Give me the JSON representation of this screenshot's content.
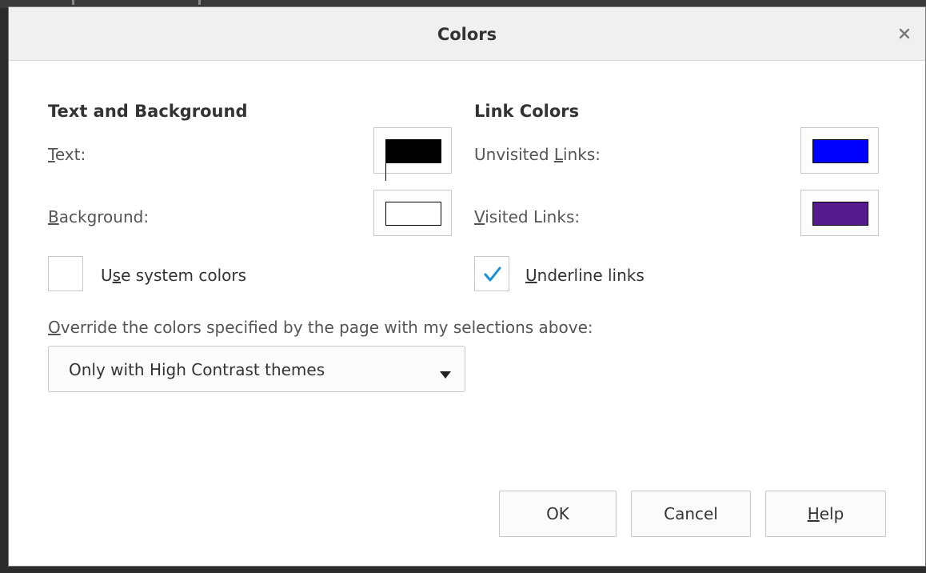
{
  "dialog": {
    "title": "Colors"
  },
  "text_background": {
    "heading": "Text and Background",
    "text_label": {
      "mnemonic": "T",
      "rest": "ext:"
    },
    "text_color": "#000000",
    "background_label": {
      "mnemonic": "B",
      "rest": "ackground:"
    },
    "background_color": "#ffffff",
    "use_system_colors": {
      "before": "U",
      "mnemonic": "s",
      "after": "e system colors",
      "checked": false
    }
  },
  "link_colors": {
    "heading": "Link Colors",
    "unvisited_label": {
      "before": "Unvisited ",
      "mnemonic": "L",
      "after": "inks:"
    },
    "unvisited_color": "#0000ff",
    "visited_label": {
      "mnemonic": "V",
      "rest": "isited Links:"
    },
    "visited_color": "#551a8b",
    "underline_links": {
      "mnemonic": "U",
      "rest": "nderline links",
      "checked": true
    }
  },
  "override": {
    "label": {
      "mnemonic": "O",
      "rest": "verride the colors specified by the page with my selections above:"
    },
    "selected": "Only with High Contrast themes"
  },
  "buttons": {
    "ok": "OK",
    "cancel": "Cancel",
    "help": {
      "mnemonic": "H",
      "rest": "elp"
    }
  },
  "icons": {
    "close": "close-icon",
    "check": "checkmark-icon",
    "caret": "dropdown-arrow-icon"
  },
  "colors": {
    "check_accent": "#1a8fd8",
    "titlebar_bg": "#f0f0f0"
  }
}
